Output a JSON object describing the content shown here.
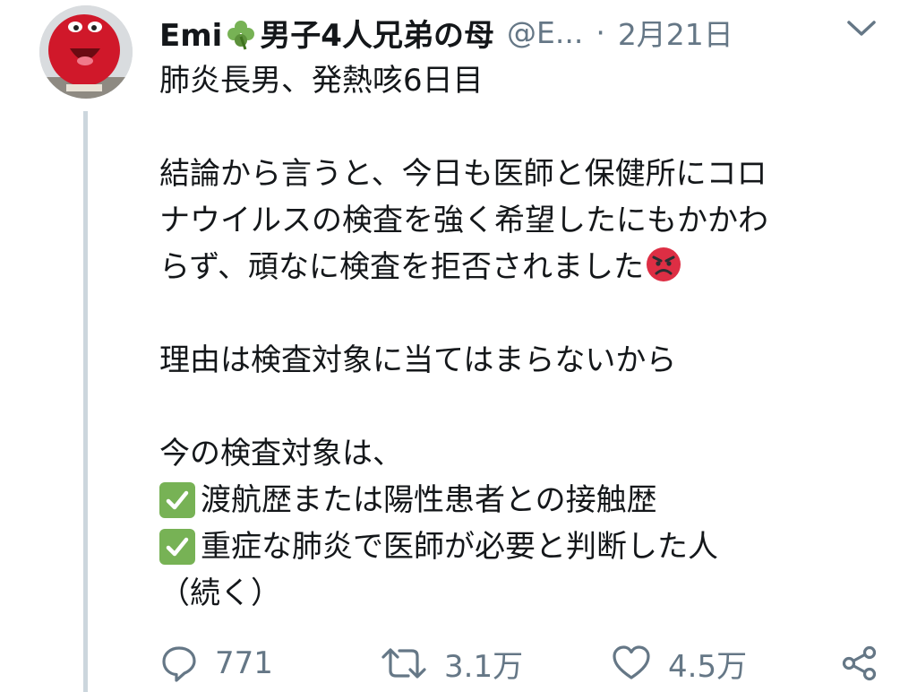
{
  "tweet": {
    "author_name": "Emi",
    "author_suffix": "男子4人兄弟の母",
    "handle": "@E...",
    "separator": "·",
    "date": "2月21日",
    "text_lines": [
      "肺炎長男、発熱咳6日目",
      "",
      "結論から言うと、今日も医師と保健所にコロ",
      "ナウイルスの検査を強く希望したにもかかわ",
      "らず、頑なに検査を拒否されました",
      "",
      "理由は検査対象に当てはまらないから",
      "",
      "今の検査対象は、"
    ],
    "checklist": [
      "渡航歴または陽性患者との接触歴",
      "重症な肺炎で医師が必要と判断した人"
    ],
    "closing": "（続く）",
    "emoji": {
      "author": "four-leaf-clover",
      "angry": "angry-face",
      "check": "white-check-mark"
    }
  },
  "actions": {
    "reply_count": "771",
    "retweet_count": "3.1万",
    "like_count": "4.5万"
  },
  "colors": {
    "text": "#14171a",
    "muted": "#657786",
    "thread_line": "#ccd6dd",
    "check_green": "#77b255",
    "angry_red": "#dd2e44"
  }
}
